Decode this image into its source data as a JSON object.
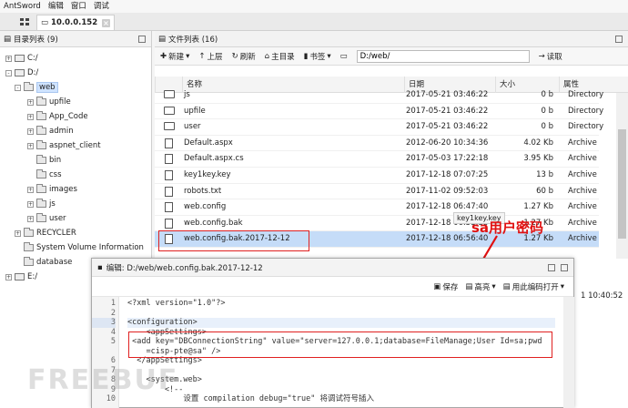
{
  "app": {
    "name": "AntSword",
    "menus": [
      "编辑",
      "窗口",
      "调试"
    ]
  },
  "tab": {
    "label": "10.0.0.152"
  },
  "dir_panel": {
    "title": "目录列表 (9)",
    "tree": [
      {
        "label": "C:/",
        "type": "drive"
      },
      {
        "label": "D:/",
        "type": "drive"
      },
      {
        "label": "web",
        "type": "folder"
      },
      {
        "label": "upfile",
        "type": "folder"
      },
      {
        "label": "App_Code",
        "type": "folder"
      },
      {
        "label": "admin",
        "type": "folder"
      },
      {
        "label": "aspnet_client",
        "type": "folder"
      },
      {
        "label": "bin",
        "type": "folder"
      },
      {
        "label": "css",
        "type": "folder"
      },
      {
        "label": "images",
        "type": "folder"
      },
      {
        "label": "js",
        "type": "folder"
      },
      {
        "label": "user",
        "type": "folder"
      },
      {
        "label": "RECYCLER",
        "type": "folder"
      },
      {
        "label": "System Volume Information",
        "type": "folder"
      },
      {
        "label": "database",
        "type": "folder"
      },
      {
        "label": "E:/",
        "type": "drive"
      }
    ]
  },
  "file_panel": {
    "title": "文件列表 (16)",
    "toolbar": {
      "new": "新建",
      "up": "上层",
      "refresh": "刷新",
      "home": "主目录",
      "bookmark": "书签",
      "path": "D:/web/",
      "read": "读取"
    },
    "columns": {
      "name": "名称",
      "date": "日期",
      "size": "大小",
      "attr": "属性"
    },
    "rows": [
      {
        "name": "js",
        "date": "2017-05-21 03:46:22",
        "size": "0 b",
        "attr": "Directory",
        "kind": "folder"
      },
      {
        "name": "upfile",
        "date": "2017-05-21 03:46:22",
        "size": "0 b",
        "attr": "Directory",
        "kind": "folder"
      },
      {
        "name": "user",
        "date": "2017-05-21 03:46:22",
        "size": "0 b",
        "attr": "Directory",
        "kind": "folder"
      },
      {
        "name": "Default.aspx",
        "date": "2012-06-20 10:34:36",
        "size": "4.02 Kb",
        "attr": "Archive",
        "kind": "file"
      },
      {
        "name": "Default.aspx.cs",
        "date": "2017-05-03 17:22:18",
        "size": "3.95 Kb",
        "attr": "Archive",
        "kind": "file"
      },
      {
        "name": "key1key.key",
        "date": "2017-12-18 07:07:25",
        "size": "13 b",
        "attr": "Archive",
        "kind": "file"
      },
      {
        "name": "robots.txt",
        "date": "2017-11-02 09:52:03",
        "size": "60 b",
        "attr": "Archive",
        "kind": "file"
      },
      {
        "name": "web.config",
        "date": "2017-12-18 06:47:40",
        "size": "1.27 Kb",
        "attr": "Archive",
        "kind": "file"
      },
      {
        "name": "web.config.bak",
        "date": "2017-12-18 06:53:38",
        "size": "1.27 Kb",
        "attr": "Archive",
        "kind": "file"
      },
      {
        "name": "web.config.bak.2017-12-12",
        "date": "2017-12-18 06:56:40",
        "size": "1.27 Kb",
        "attr": "Archive",
        "kind": "file"
      }
    ],
    "tooltip": "key1key.key",
    "time_fragment": "1 10:40:52"
  },
  "annotation": {
    "text": "sa用户密码",
    "color": "#e01010"
  },
  "editor": {
    "title": "编辑: D:/web/web.config.bak.2017-12-12",
    "save": "保存",
    "highlight": "高亮",
    "open_with_encoding": "用此编码打开",
    "lines": [
      {
        "n": "1",
        "code": "<?xml version=\"1.0\"?>"
      },
      {
        "n": "2",
        "code": ""
      },
      {
        "n": "3",
        "code": "<configuration>"
      },
      {
        "n": "4",
        "code": "    <appSettings>"
      },
      {
        "n": "5",
        "code": " <add key=\"DBConnectionString\" value=\"server=127.0.0.1;database=FileManage;User Id=sa;pwd"
      },
      {
        "n": "",
        "code": "    =cisp-pte@sa\" />"
      },
      {
        "n": "6",
        "code": "  </appSettings>"
      },
      {
        "n": "7",
        "code": ""
      },
      {
        "n": "8",
        "code": "    <system.web>"
      },
      {
        "n": "9",
        "code": "        <!--"
      },
      {
        "n": "10",
        "code": "            设置 compilation debug=\"true\" 将调试符号插入"
      }
    ]
  },
  "watermark": "FREEBUF"
}
